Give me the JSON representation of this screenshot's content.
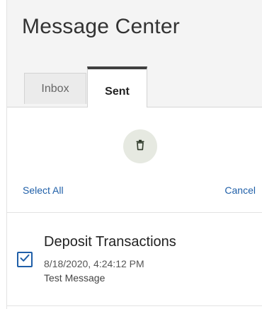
{
  "header": {
    "title": "Message Center"
  },
  "tabs": [
    {
      "label": "Inbox",
      "active": false
    },
    {
      "label": "Sent",
      "active": true
    }
  ],
  "toolbar": {
    "delete_icon": "trash-icon",
    "select_all_label": "Select All",
    "cancel_label": "Cancel"
  },
  "messages": [
    {
      "selected": true,
      "subject": "Deposit Transactions",
      "timestamp": "8/18/2020, 4:24:12 PM",
      "body": "Test Message"
    }
  ],
  "colors": {
    "link": "#1f5fa8",
    "header_bg": "#f4f4f4",
    "active_tab_border": "#404040",
    "delete_button_bg": "#e6e9e1",
    "checkbox": "#1f5fa8"
  }
}
